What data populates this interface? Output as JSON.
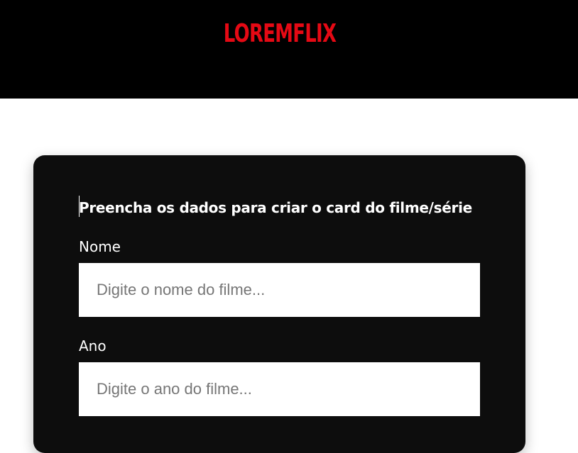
{
  "header": {
    "logo_text": "LOREMFLIX"
  },
  "form": {
    "title": "Preencha os dados para criar o card do filme/série",
    "fields": [
      {
        "label": "Nome",
        "value": "",
        "placeholder": "Digite o nome do filme..."
      },
      {
        "label": "Ano",
        "value": "",
        "placeholder": "Digite o ano do filme..."
      }
    ]
  },
  "colors": {
    "header_background": "#000000",
    "logo": "#e50914",
    "card_background": "#0d0d0d",
    "page_background": "#ffffff",
    "text_on_card": "#ffffff"
  }
}
